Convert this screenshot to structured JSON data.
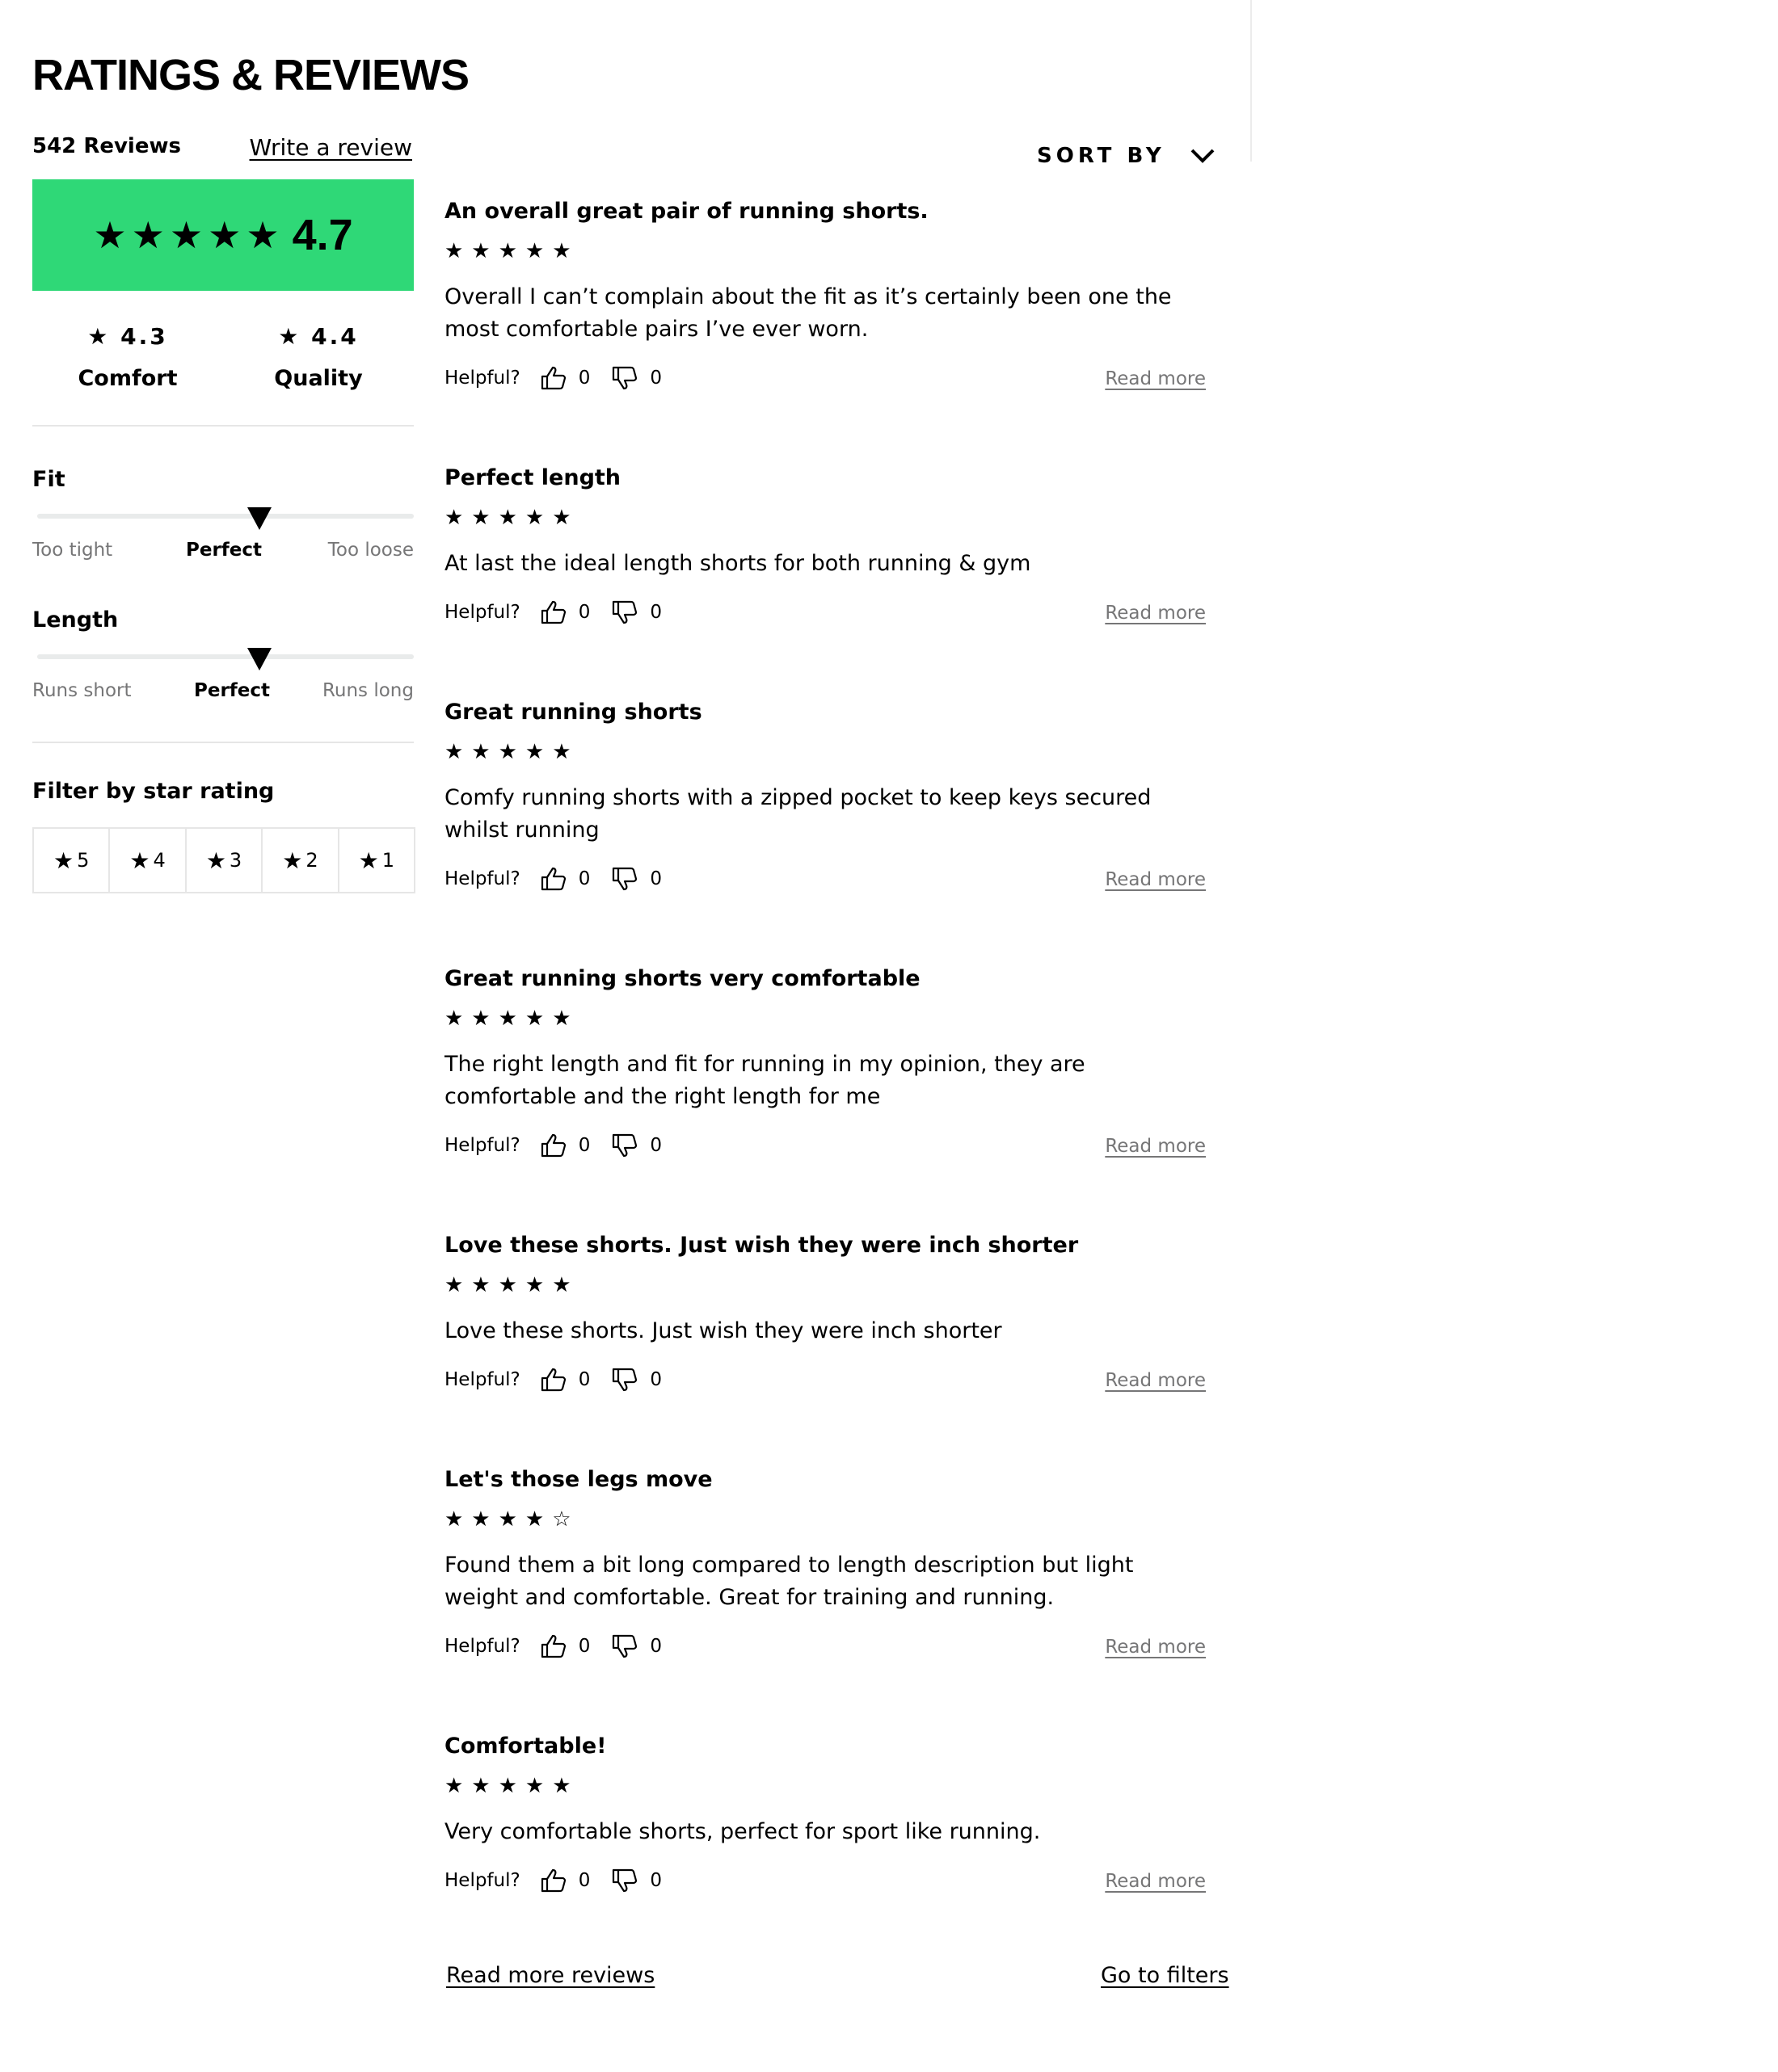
{
  "header": {
    "title": "RATINGS & REVIEWS"
  },
  "summary": {
    "reviews_count": "542 Reviews",
    "write_review": "Write a review",
    "overall_stars": "★★★★★",
    "overall_score": "4.7",
    "overall_color": "#2fd877",
    "comfort": {
      "value": "★ 4.3",
      "label": "Comfort"
    },
    "quality": {
      "value": "★ 4.4",
      "label": "Quality"
    }
  },
  "fit": {
    "label": "Fit",
    "min": "Too tight",
    "mid": "Perfect",
    "max": "Too loose",
    "position_fraction": 0.59
  },
  "length": {
    "label": "Length",
    "min": "Runs short",
    "mid": "Perfect",
    "max": "Runs long",
    "position_fraction": 0.59
  },
  "filter": {
    "label": "Filter by star rating",
    "options": [
      "5",
      "4",
      "3",
      "2",
      "1"
    ],
    "star_glyph": "★"
  },
  "sort": {
    "label": "SORT BY",
    "icon": "chevron-down-icon"
  },
  "review_ui": {
    "helpful_label": "Helpful?",
    "read_more_label": "Read more",
    "thumbs_up_icon": "thumbs-up-icon",
    "thumbs_down_icon": "thumbs-down-icon"
  },
  "reviews": [
    {
      "title": "An overall great pair of running shorts.",
      "stars": "★★★★★",
      "body": "Overall I can’t complain about the fit as it’s certainly been one the most comfortable pairs I’ve ever worn.",
      "helpful_yes": "0",
      "helpful_no": "0"
    },
    {
      "title": "Perfect length",
      "stars": "★★★★★",
      "body": "At last the ideal length shorts for both running & gym",
      "helpful_yes": "0",
      "helpful_no": "0"
    },
    {
      "title": "Great running shorts",
      "stars": "★★★★★",
      "body": "Comfy running shorts with a zipped pocket to keep keys secured whilst running",
      "helpful_yes": "0",
      "helpful_no": "0"
    },
    {
      "title": "Great running shorts very comfortable",
      "stars": "★★★★★",
      "body": "The right length and fit for running in my opinion, they are comfortable and the right length for me",
      "helpful_yes": "0",
      "helpful_no": "0"
    },
    {
      "title": "Love these shorts. Just wish they were inch shorter",
      "stars": "★★★★★",
      "body": "Love these shorts. Just wish they were inch shorter",
      "helpful_yes": "0",
      "helpful_no": "0"
    },
    {
      "title": "Let's those legs move",
      "stars": "★★★★☆",
      "body": "Found them a bit long compared to length description but light weight and comfortable. Great for training and running.",
      "helpful_yes": "0",
      "helpful_no": "0"
    },
    {
      "title": "Comfortable!",
      "stars": "★★★★★",
      "body": "Very comfortable shorts, perfect for sport like running.",
      "helpful_yes": "0",
      "helpful_no": "0"
    }
  ],
  "footer": {
    "read_more_reviews": "Read more reviews",
    "go_to_filters": "Go to filters"
  }
}
